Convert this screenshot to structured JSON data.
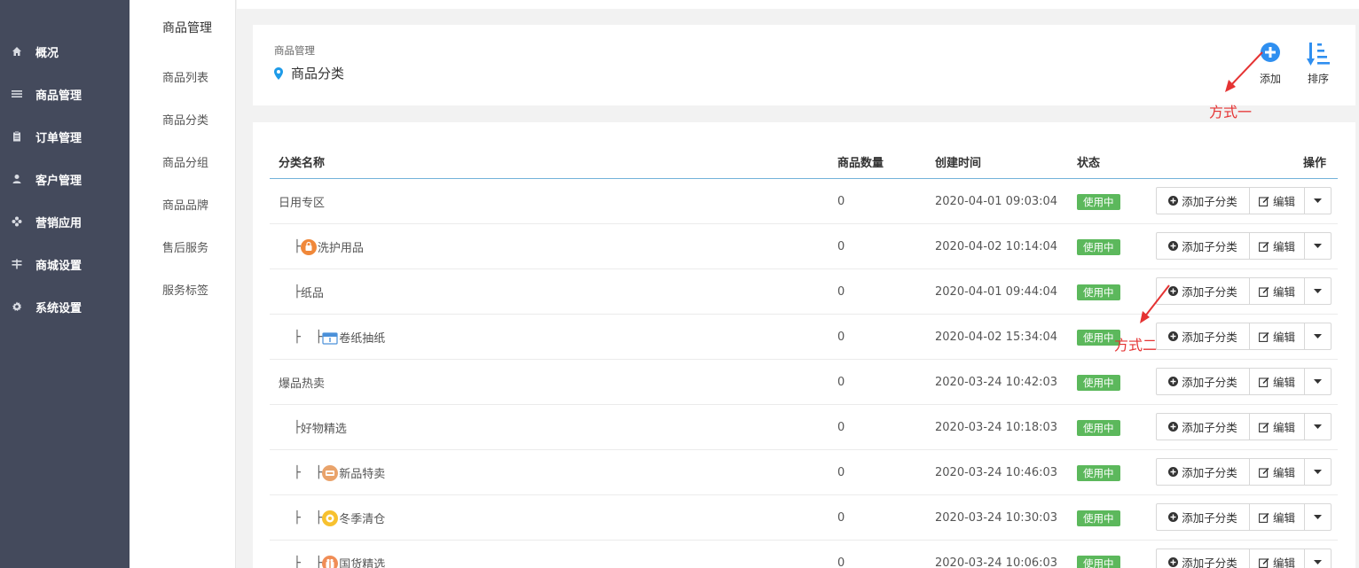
{
  "sidebar": {
    "items": [
      {
        "label": "概况",
        "icon": "home-icon"
      },
      {
        "label": "商品管理",
        "icon": "menu-icon"
      },
      {
        "label": "订单管理",
        "icon": "clipboard-icon"
      },
      {
        "label": "客户管理",
        "icon": "user-icon"
      },
      {
        "label": "营销应用",
        "icon": "gamepad-icon"
      },
      {
        "label": "商城设置",
        "icon": "shop-settings-icon"
      },
      {
        "label": "系统设置",
        "icon": "gear-icon"
      }
    ]
  },
  "subnav": {
    "title": "商品管理",
    "items": [
      "商品列表",
      "商品分类",
      "商品分组",
      "商品品牌",
      "售后服务",
      "服务标签"
    ]
  },
  "header": {
    "breadcrumb": "商品管理",
    "title": "商品分类",
    "add_label": "添加",
    "sort_label": "排序"
  },
  "table": {
    "columns": {
      "name": "分类名称",
      "count": "商品数量",
      "created": "创建时间",
      "status": "状态",
      "actions": "操作"
    },
    "rows": [
      {
        "prefix": "",
        "icon": "",
        "name": "日用专区",
        "count": "0",
        "created": "2020-04-01 09:03:04",
        "status": "使用中"
      },
      {
        "prefix": "├",
        "icon": "orange-bag-icon",
        "name": "洗护用品",
        "count": "0",
        "created": "2020-04-02 10:14:04",
        "status": "使用中"
      },
      {
        "prefix": "├",
        "icon": "",
        "name": "纸品",
        "count": "0",
        "created": "2020-04-01 09:44:04",
        "status": "使用中"
      },
      {
        "prefix": "├    ├",
        "icon": "tissue-box-icon",
        "name": "卷纸抽纸",
        "count": "0",
        "created": "2020-04-02 15:34:04",
        "status": "使用中"
      },
      {
        "prefix": "",
        "icon": "",
        "name": "爆品热卖",
        "count": "0",
        "created": "2020-03-24 10:42:03",
        "status": "使用中"
      },
      {
        "prefix": "├",
        "icon": "",
        "name": "好物精选",
        "count": "0",
        "created": "2020-03-24 10:18:03",
        "status": "使用中"
      },
      {
        "prefix": "├    ├",
        "icon": "new-product-icon",
        "name": "新品特卖",
        "count": "0",
        "created": "2020-03-24 10:46:03",
        "status": "使用中"
      },
      {
        "prefix": "├    ├",
        "icon": "winter-sale-icon",
        "name": "冬季清仓",
        "count": "0",
        "created": "2020-03-24 10:30:03",
        "status": "使用中"
      },
      {
        "prefix": "├    ├",
        "icon": "gift-icon",
        "name": "国货精选",
        "count": "0",
        "created": "2020-03-24 10:06:03",
        "status": "使用中"
      }
    ],
    "add_child_label": "添加子分类",
    "edit_label": "编辑"
  },
  "annotations": {
    "method_one": "方式一",
    "method_two": "方式二"
  },
  "colors": {
    "sidebar_bg": "#444a5c",
    "accent_blue": "#1e90ff",
    "status_green": "#5cb85c",
    "annotation_red": "#e53333"
  }
}
